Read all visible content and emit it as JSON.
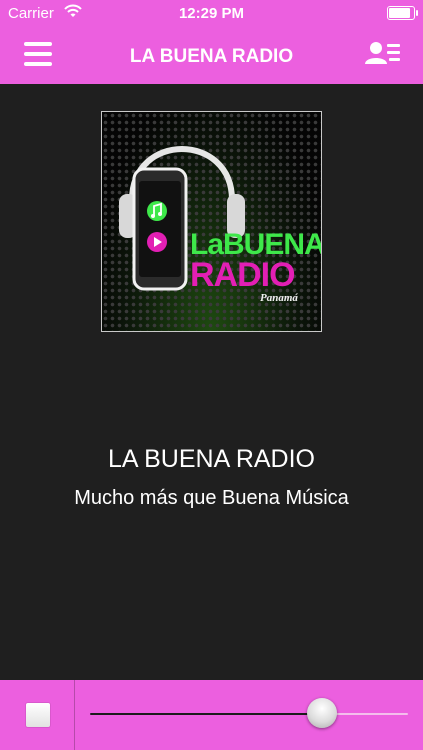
{
  "status_bar": {
    "carrier": "Carrier",
    "time": "12:29 PM",
    "battery_level": 0.95
  },
  "navbar": {
    "title": "LA BUENA RADIO",
    "left_icon": "hamburger-menu-icon",
    "right_icon": "contact-list-icon"
  },
  "logo": {
    "line1": "LaBUENA",
    "line2": "RADIO",
    "line3": "Panamá"
  },
  "station": {
    "name": "LA BUENA RADIO",
    "slogan": "Mucho más que Buena Música"
  },
  "player": {
    "stop_icon": "stop-icon",
    "volume_level": 0.73
  },
  "colors": {
    "accent": "#ec5fdf",
    "background": "#1f1f1f",
    "logo_green": "#3ee84a",
    "logo_pink": "#e21fb4"
  }
}
